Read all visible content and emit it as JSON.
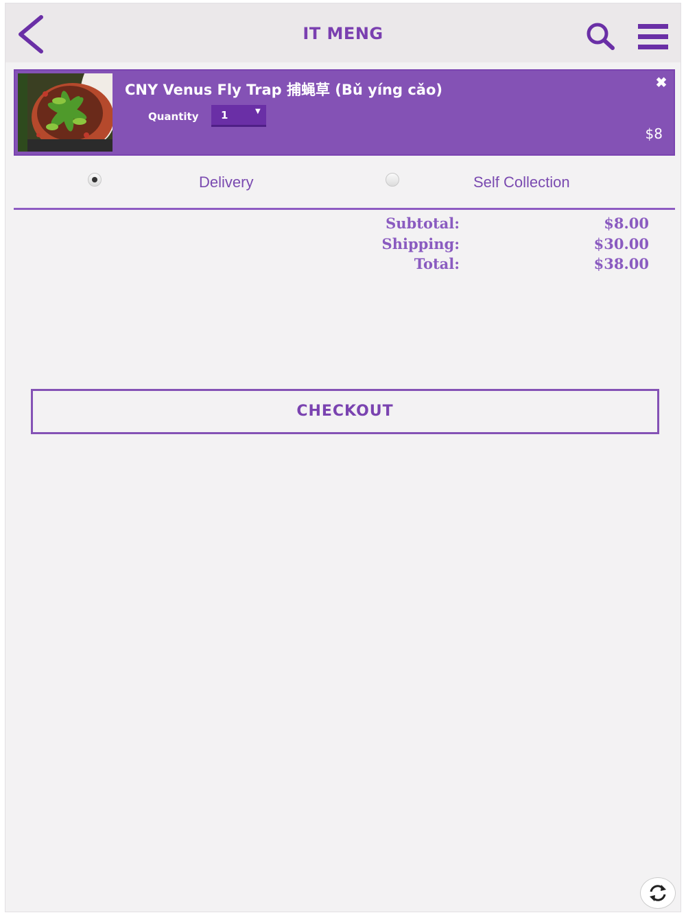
{
  "header": {
    "title": "IT MENG",
    "back_icon": "chevron-left-icon",
    "search_icon": "search-icon",
    "menu_icon": "hamburger-menu-icon"
  },
  "cart": {
    "items": [
      {
        "title": "CNY Venus Fly Trap 捕蝇草 (Bǔ yíng cǎo)",
        "quantity_label": "Quantity",
        "quantity": "1",
        "price": "$8",
        "remove_icon": "close-icon"
      }
    ]
  },
  "shipping": {
    "options": [
      {
        "label": "Delivery",
        "selected": true
      },
      {
        "label": "Self Collection",
        "selected": false
      }
    ]
  },
  "totals": {
    "subtotal_label": "Subtotal:",
    "subtotal_value": "$8.00",
    "shipping_label": "Shipping:",
    "shipping_value": "$30.00",
    "total_label": "Total:",
    "total_value": "$38.00"
  },
  "checkout": {
    "label": "CHECKOUT"
  },
  "refresh_icon": "refresh-icon",
  "colors": {
    "accent": "#8452b5",
    "accent_dark": "#6a2fa6",
    "text_accent": "#7a43b0",
    "background": "#f3f2f3",
    "header_bg": "#ebe8ea"
  }
}
